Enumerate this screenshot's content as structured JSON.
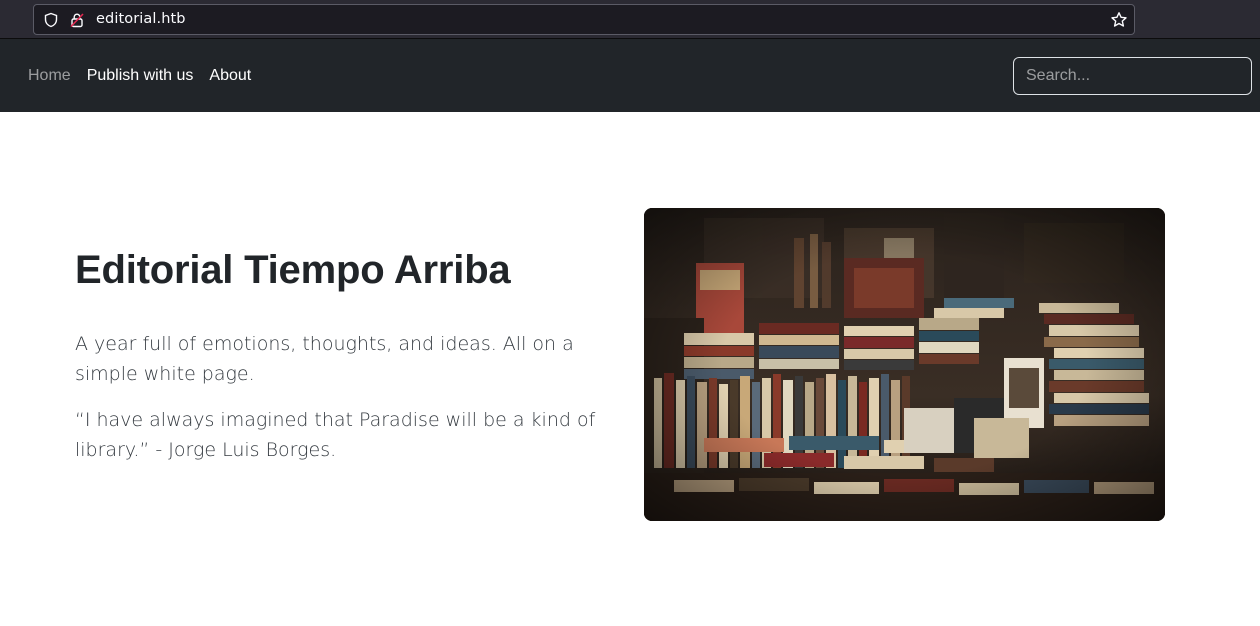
{
  "browser": {
    "url": "editorial.htb",
    "icons": [
      "shield-icon",
      "lock-icon",
      "bookmark-star-icon"
    ]
  },
  "nav": {
    "links": [
      {
        "label": "Home",
        "active": false
      },
      {
        "label": "Publish with us"
      },
      {
        "label": "About"
      }
    ],
    "search_placeholder": "Search..."
  },
  "hero": {
    "title": "Editorial Tiempo Arriba",
    "lead": "A year full of emotions, thoughts, and ideas. All on a simple white page.",
    "quote": "“I have always imagined that Paradise will be a kind of library.” - Jorge Luis Borges.",
    "image_description": "pile-of-books-photo"
  },
  "colors": {
    "navbar_bg": "#212529",
    "browser_bg": "#2b2a33",
    "text": "#212529"
  }
}
